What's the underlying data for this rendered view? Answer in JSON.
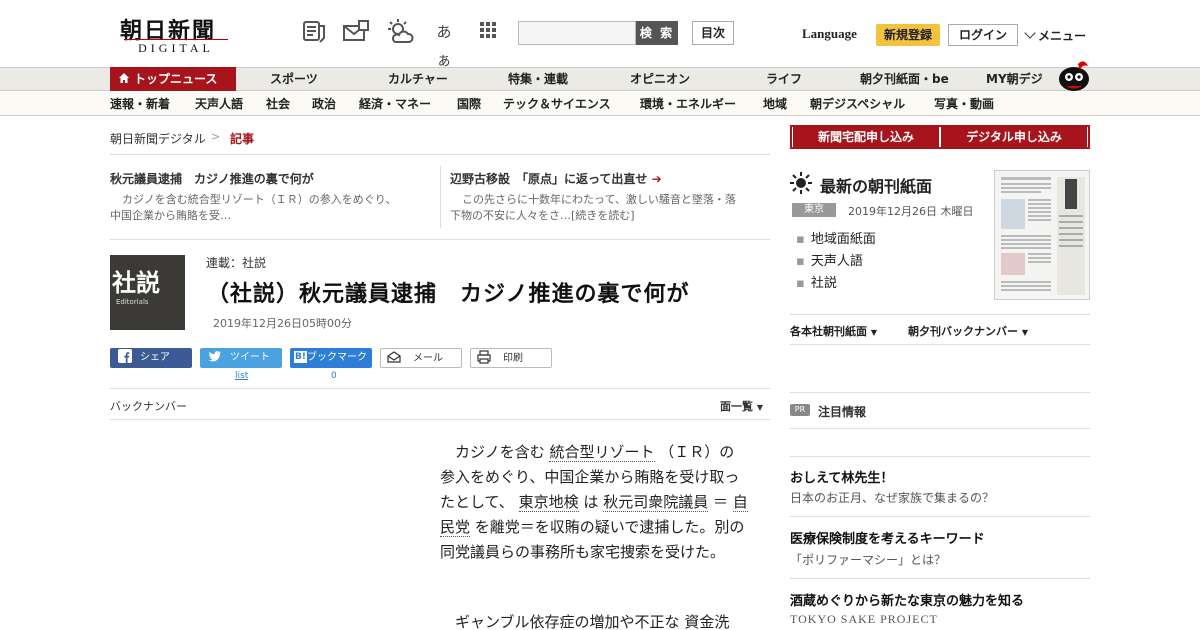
{
  "header": {
    "logo": "朝日新聞",
    "logo_sub": "DIGITAL",
    "search_button": "検 索",
    "toc_button": "目次",
    "language": "Language",
    "register": "新規登録",
    "login": "ログイン",
    "menu": "メニュー",
    "font_size_icon_text": "あぁ",
    "icons": [
      "newspaper-icon",
      "mail-icon",
      "weather-icon",
      "font-size-icon",
      "grid-icon",
      "search-icon"
    ]
  },
  "nav_primary": [
    "トップニュース",
    "スポーツ",
    "カルチャー",
    "特集・連載",
    "オピニオン",
    "ライフ",
    "朝夕刊紙面・be",
    "MY朝デジ"
  ],
  "nav_secondary": [
    "速報・新着",
    "天声人語",
    "社会",
    "政治",
    "経済・マネー",
    "国際",
    "テック＆サイエンス",
    "環境・エネルギー",
    "地域",
    "朝デジスペシャル",
    "写真・動画"
  ],
  "breadcrumb": {
    "home": "朝日新聞デジタル",
    "separator": ">",
    "current": "記事"
  },
  "teasers": [
    {
      "title": "秋元議員逮捕　カジノ推進の裏で何が",
      "body_1": "カジノを含む統合型リゾート（ＩＲ）の参入をめぐり、",
      "body_2": "中国企業から賄賂を受…"
    },
    {
      "title": "辺野古移設　「原点」に返って出直せ",
      "body_1": "この先さらに十数年にわたって、激しい騒音と墜落・落",
      "body_2": "下物の不安に人々をさ…[続きを読む]"
    }
  ],
  "article": {
    "thumb_kanji": "社説",
    "thumb_en": "Editorials",
    "series": "連載：社説",
    "title": "（社説）秋元議員逮捕　カジノ推進の裏で何が",
    "date": "2019年12月26日05時00分",
    "share": {
      "facebook": "シェア",
      "twitter": "ツイート",
      "hatena": "ブックマーク",
      "hatena_mark": "B!",
      "mail": "メール",
      "print": "印刷",
      "twitter_count": "list",
      "hatena_count": "0"
    },
    "back_number": "バックナンバー",
    "list_all": "面一覧",
    "p1": {
      "a": "カジノを含む",
      "b": "統合型リゾート",
      "c": "（ＩＲ）の参入をめぐり、中国企業から賄賂を受け取ったとして、",
      "d": "東京地検",
      "e": "は",
      "f": "秋元司衆院議員",
      "g": "＝",
      "h": "自民党",
      "i": "を離党＝を収賄の疑いで逮捕した。別の同党議員らの事務所も家宅捜索を受けた。"
    },
    "p2": {
      "a": "ギャンブル依存症の増加や不正な",
      "b": "資金洗"
    }
  },
  "sidebar": {
    "apply_home": "新聞宅配申し込み",
    "apply_digital": "デジタル申し込み",
    "paper_title": "最新の朝刊紙面",
    "paper_region": "東京",
    "paper_date": "2019年12月26日 木曜日",
    "paper_links": [
      "地域面紙面",
      "天声人語",
      "社説"
    ],
    "dropdown_1": "各本社朝刊紙面",
    "dropdown_2": "朝夕刊バックナンバー",
    "pr_tag": "PR",
    "pr_title": "注目情報",
    "pr_items": [
      {
        "title": "おしえて林先生！",
        "sub": "日本のお正月、なぜ家族で集まるの？"
      },
      {
        "title": "医療保険制度を考えるキーワード",
        "sub": "「ポリファーマシー」とは？"
      },
      {
        "title": "酒蔵めぐりから新たな東京の魅力を知る",
        "sub": "TOKYO SAKE PROJECT"
      }
    ]
  },
  "colors": {
    "brand_red": "#a7141c",
    "register_yellow": "#f3c340",
    "facebook": "#3c5a96",
    "twitter": "#4aa3e0",
    "hatena": "#2d7ed8"
  }
}
